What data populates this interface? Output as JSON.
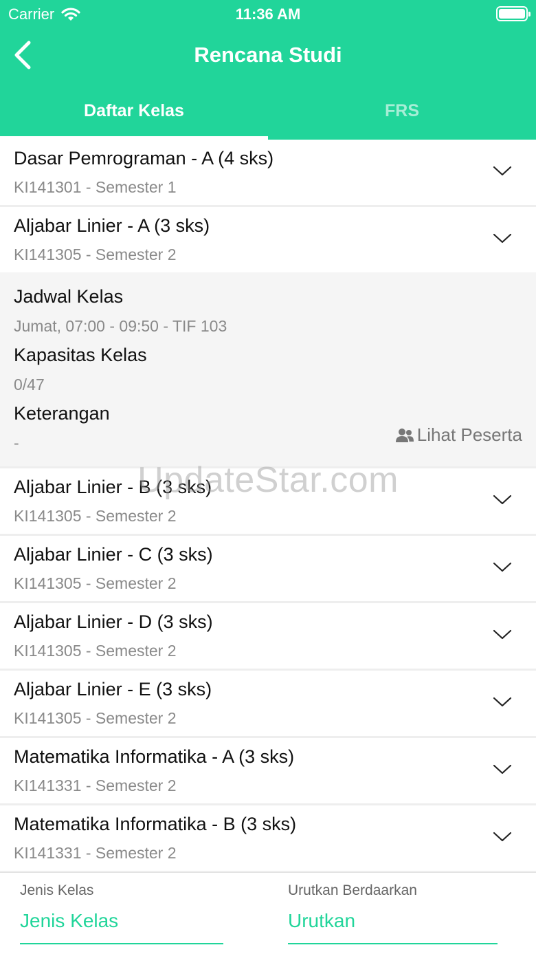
{
  "status_bar": {
    "carrier": "Carrier",
    "time": "11:36 AM"
  },
  "nav": {
    "title": "Rencana Studi"
  },
  "tabs": [
    {
      "label": "Daftar Kelas",
      "active": true
    },
    {
      "label": "FRS",
      "active": false
    }
  ],
  "courses_top": [
    {
      "title": "Dasar Pemrograman - A (4 sks)",
      "subtitle": "KI141301 - Semester 1"
    },
    {
      "title": "Aljabar Linier - A (3 sks)",
      "subtitle": "KI141305 - Semester 2"
    }
  ],
  "detail": {
    "schedule_label": "Jadwal Kelas",
    "schedule_value": "Jumat, 07:00 - 09:50 - TIF 103",
    "capacity_label": "Kapasitas Kelas",
    "capacity_value": "0/47",
    "notes_label": "Keterangan",
    "notes_value": "-",
    "participants_label": "Lihat Peserta"
  },
  "courses_bottom": [
    {
      "title": "Aljabar Linier - B (3 sks)",
      "subtitle": "KI141305 - Semester 2"
    },
    {
      "title": "Aljabar Linier - C (3 sks)",
      "subtitle": "KI141305 - Semester 2"
    },
    {
      "title": "Aljabar Linier - D (3 sks)",
      "subtitle": "KI141305 - Semester 2"
    },
    {
      "title": "Aljabar Linier - E (3 sks)",
      "subtitle": "KI141305 - Semester 2"
    },
    {
      "title": "Matematika Informatika - A (3 sks)",
      "subtitle": "KI141331 - Semester 2"
    },
    {
      "title": "Matematika Informatika - B (3 sks)",
      "subtitle": "KI141331 - Semester 2"
    }
  ],
  "filters": {
    "class_type_label": "Jenis Kelas",
    "class_type_value": "Jenis Kelas",
    "sort_label": "Urutkan Berdaarkan",
    "sort_value": "Urutkan"
  },
  "watermark": "UpdateStar.com",
  "colors": {
    "primary": "#21d59a",
    "muted_text": "#8a8a8a",
    "detail_bg": "#f5f5f5"
  },
  "icons": [
    "wifi-icon",
    "battery-icon",
    "back-chevron-icon",
    "chevron-down-icon",
    "users-icon"
  ]
}
